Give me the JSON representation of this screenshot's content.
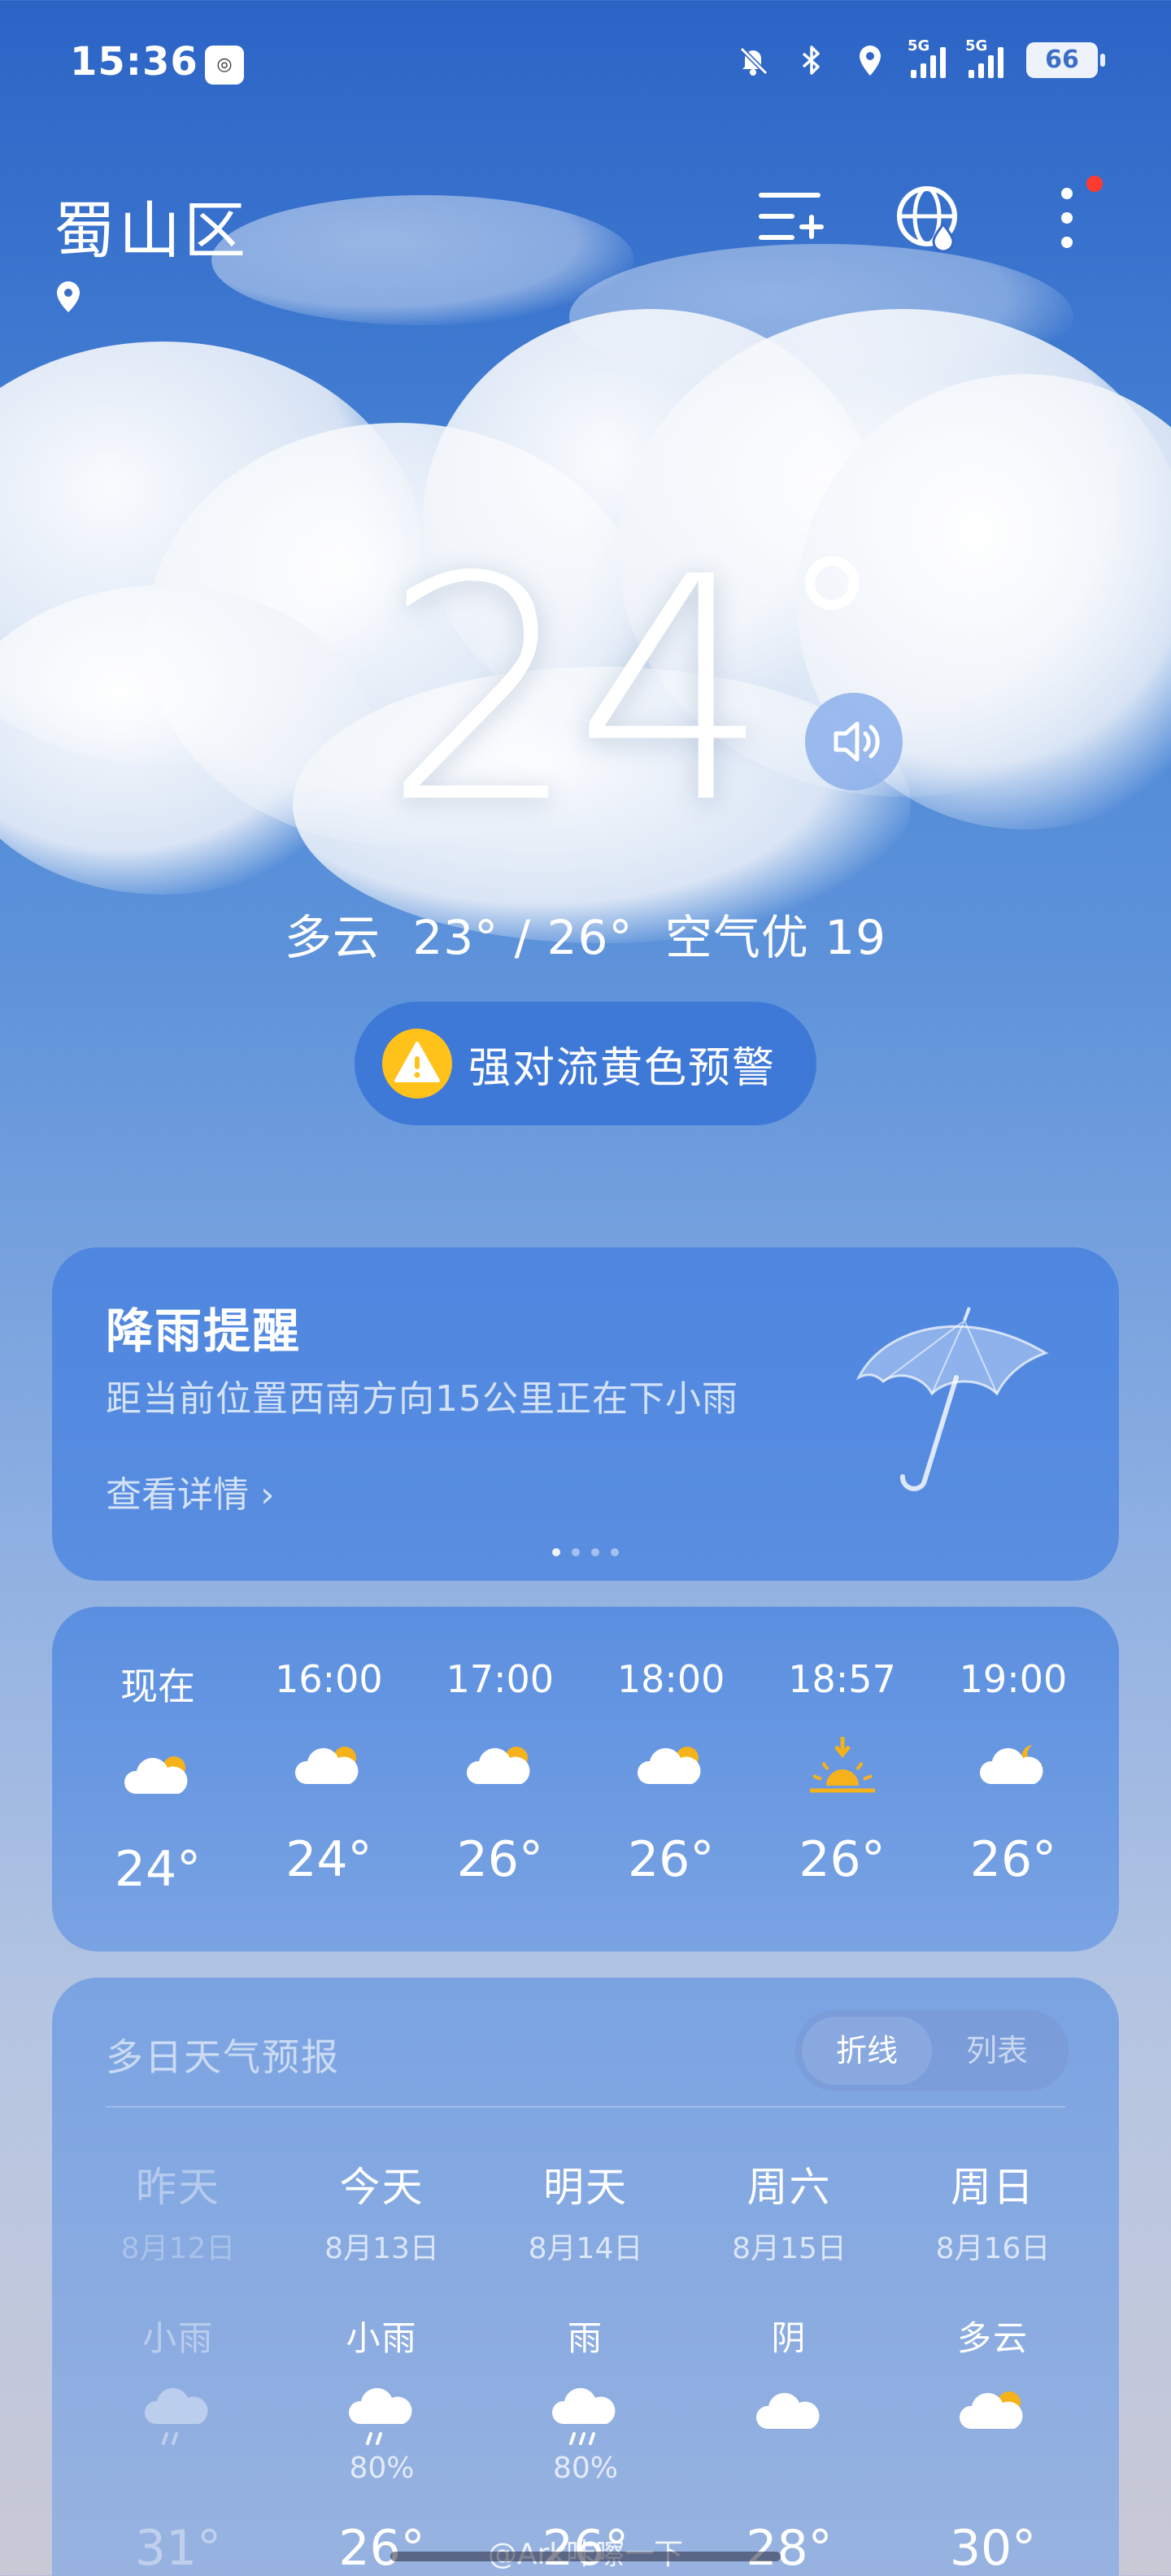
{
  "status": {
    "time": "15:36",
    "network1": "5G",
    "network2": "5G",
    "battery": "66"
  },
  "header": {
    "city": "蜀山区"
  },
  "current": {
    "temp": "24",
    "condition": "多云",
    "range": "23° / 26°",
    "air": "空气优 19"
  },
  "alert": {
    "label": "强对流黄色预警"
  },
  "rain_card": {
    "title": "降雨提醒",
    "desc": "距当前位置西南方向15公里正在下小雨",
    "link": "查看详情 ›",
    "page_count": 4,
    "active_page": 1
  },
  "hourly": [
    {
      "time": "现在",
      "icon": "partly-cloudy-icon",
      "temp": "24°"
    },
    {
      "time": "16:00",
      "icon": "partly-cloudy-icon",
      "temp": "24°"
    },
    {
      "time": "17:00",
      "icon": "partly-cloudy-icon",
      "temp": "26°"
    },
    {
      "time": "18:00",
      "icon": "partly-cloudy-icon",
      "temp": "26°"
    },
    {
      "time": "18:57",
      "icon": "sunset-icon",
      "temp": "26°"
    },
    {
      "time": "19:00",
      "icon": "partly-cloudy-night-icon",
      "temp": "26°"
    }
  ],
  "daily": {
    "title": "多日天气预报",
    "toggle_line": "折线",
    "toggle_list": "列表",
    "days": [
      {
        "day": "昨天",
        "date": "8月12日",
        "cond": "小雨",
        "icon": "light-rain-icon",
        "pop": "",
        "high": "31°"
      },
      {
        "day": "今天",
        "date": "8月13日",
        "cond": "小雨",
        "icon": "light-rain-icon",
        "pop": "80%",
        "high": "26°"
      },
      {
        "day": "明天",
        "date": "8月14日",
        "cond": "雨",
        "icon": "rain-icon",
        "pop": "80%",
        "high": "26°"
      },
      {
        "day": "周六",
        "date": "8月15日",
        "cond": "阴",
        "icon": "overcast-icon",
        "pop": "",
        "high": "28°"
      },
      {
        "day": "周日",
        "date": "8月16日",
        "cond": "多云",
        "icon": "partly-cloudy-icon",
        "pop": "",
        "high": "30°"
      }
    ]
  },
  "watermark": "@Ark咔嚓一下",
  "colors": {
    "accent_blue": "#3f79d8",
    "warning_yellow": "#ffc21a",
    "sun_orange": "#f6b21b"
  }
}
